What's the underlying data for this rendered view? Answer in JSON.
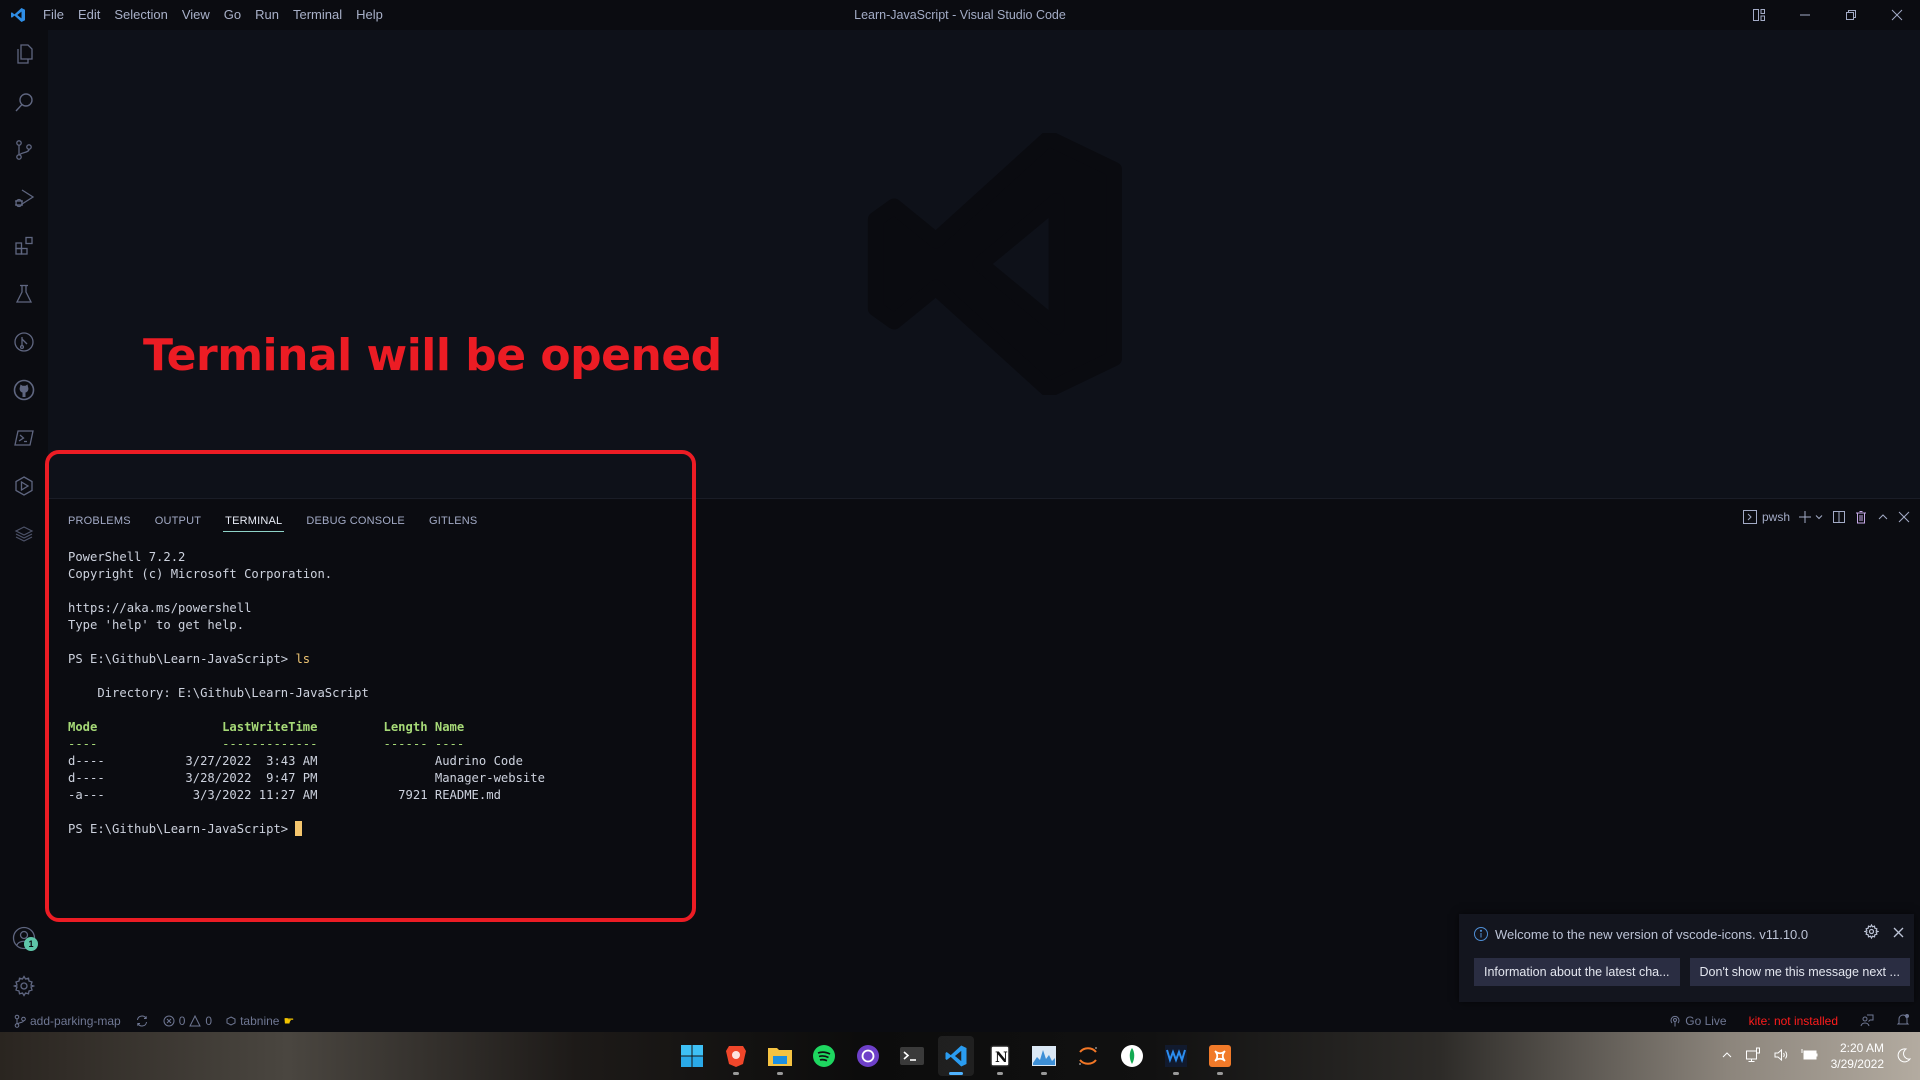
{
  "window": {
    "title": "Learn-JavaScript - Visual Studio Code",
    "menu": [
      "File",
      "Edit",
      "Selection",
      "View",
      "Go",
      "Run",
      "Terminal",
      "Help"
    ]
  },
  "activity_bar": {
    "items": [
      "explorer-icon",
      "search-icon",
      "source-control-icon",
      "run-debug-icon",
      "extensions-icon",
      "testing-icon",
      "gitlens-icon",
      "github-icon",
      "powershell-icon",
      "remote-icon",
      "layers-icon"
    ],
    "accounts_badge": "1"
  },
  "annotation": {
    "text": "Terminal will be opened",
    "color": "#ec1c24"
  },
  "panel": {
    "tabs": [
      {
        "label": "PROBLEMS",
        "active": false
      },
      {
        "label": "OUTPUT",
        "active": false
      },
      {
        "label": "TERMINAL",
        "active": true
      },
      {
        "label": "DEBUG CONSOLE",
        "active": false
      },
      {
        "label": "GITLENS",
        "active": false
      }
    ],
    "shell_name": "pwsh"
  },
  "terminal": {
    "banner1": "PowerShell 7.2.2",
    "banner2": "Copyright (c) Microsoft Corporation.",
    "banner3": "https://aka.ms/powershell",
    "banner4": "Type 'help' to get help.",
    "prompt": "PS E:\\Github\\Learn-JavaScript> ",
    "command": "ls",
    "directory_line": "    Directory: E:\\Github\\Learn-JavaScript",
    "header": "Mode                 LastWriteTime         Length Name",
    "underline": "----                 -------------         ------ ----",
    "rows": [
      "d----           3/27/2022  3:43 AM                Audrino Code",
      "d----           3/28/2022  9:47 PM                Manager-website",
      "-a---            3/3/2022 11:27 AM           7921 README.md"
    ],
    "listing": [
      {
        "mode": "d----",
        "last_write_time": "3/27/2022  3:43 AM",
        "length": "",
        "name": "Audrino Code"
      },
      {
        "mode": "d----",
        "last_write_time": "3/28/2022  9:47 PM",
        "length": "",
        "name": "Manager-website"
      },
      {
        "mode": "-a---",
        "last_write_time": "3/3/2022 11:27 AM",
        "length": "7921",
        "name": "README.md"
      }
    ]
  },
  "notification": {
    "message": "Welcome to the new version of vscode-icons. v11.10.0",
    "button1": "Information about the latest cha...",
    "button2": "Don't show me this message next ..."
  },
  "statusbar": {
    "branch": "add-parking-map",
    "errors": "0",
    "warnings": "0",
    "tabnine": "tabnine",
    "go_live": "Go Live",
    "kite": "kite: not installed"
  },
  "taskbar": {
    "apps": [
      "windows-start",
      "brave",
      "file-explorer",
      "spotify",
      "github-desktop",
      "terminal",
      "vscode",
      "notion",
      "resource-monitor",
      "jupyter",
      "mongodb-compass",
      "waves",
      "xampp"
    ],
    "active_app": "vscode",
    "time": "2:20 AM",
    "date": "3/29/2022"
  }
}
